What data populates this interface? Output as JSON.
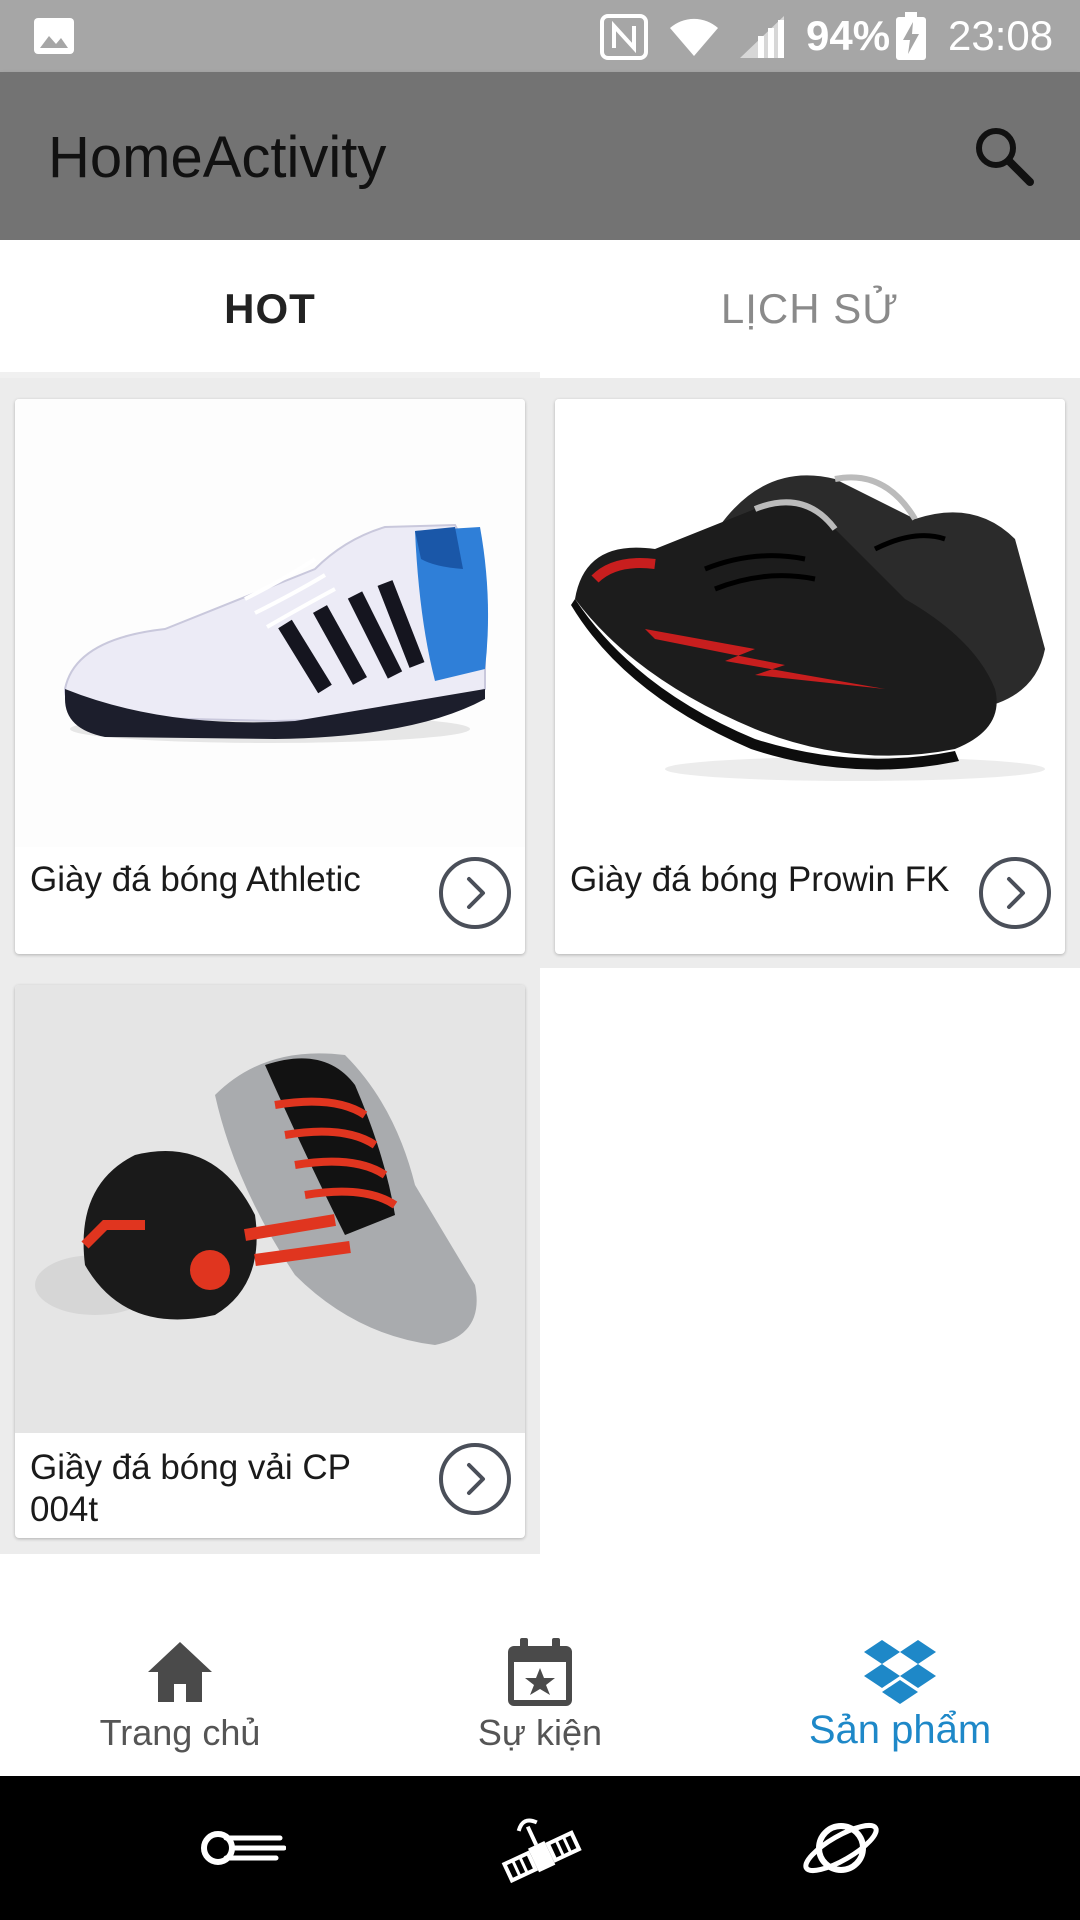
{
  "status_bar": {
    "battery": "94%",
    "time": "23:08",
    "icons": [
      "gallery-icon",
      "nfc-icon",
      "wifi-icon",
      "signal-icon",
      "battery-charging-icon"
    ]
  },
  "app_bar": {
    "title": "HomeActivity",
    "search_icon": "search-icon"
  },
  "tabs": [
    {
      "label": "HOT",
      "selected": true
    },
    {
      "label": "LỊCH SỬ",
      "selected": false
    }
  ],
  "products": [
    {
      "name": "Giày đá bóng Athletic",
      "image": "white-blue-football-shoe"
    },
    {
      "name": "Giày đá bóng Prowin FK",
      "image": "black-red-football-shoes"
    },
    {
      "name": "Giầy đá bóng vải CP 004t",
      "image": "black-silver-red-football-shoes"
    }
  ],
  "bottom_nav": [
    {
      "label": "Trang chủ",
      "icon": "home-icon",
      "active": false
    },
    {
      "label": "Sự kiện",
      "icon": "calendar-star-icon",
      "active": true
    },
    {
      "label": "Sản phẩm",
      "icon": "dropbox-icon",
      "active": true
    }
  ],
  "system_nav": [
    "comet-icon",
    "satellite-icon",
    "planet-icon"
  ],
  "colors": {
    "status_bar": "#a6a6a6",
    "app_bar": "#737373",
    "accent": "#1e88c8"
  }
}
